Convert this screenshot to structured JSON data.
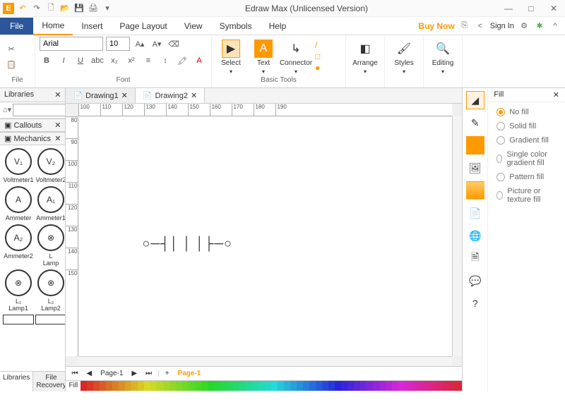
{
  "title": "Edraw Max (Unlicensed Version)",
  "menubar": {
    "file": "File",
    "items": [
      "Home",
      "Insert",
      "Page Layout",
      "View",
      "Symbols",
      "Help"
    ],
    "active": 0,
    "buynow": "Buy Now",
    "signin": "Sign In"
  },
  "ribbon": {
    "file_group": "File",
    "font_group": "Font",
    "font_name": "Arial",
    "font_size": "10",
    "basic_tools": "Basic Tools",
    "select": "Select",
    "text": "Text",
    "connector": "Connector",
    "arrange": "Arrange",
    "styles": "Styles",
    "editing": "Editing"
  },
  "libraries": {
    "title": "Libraries",
    "search_ph": "",
    "cats": [
      "Callouts",
      "Mechanics"
    ],
    "shapes": [
      {
        "sym": "V₁",
        "lbl": "Voltmeter1"
      },
      {
        "sym": "V₂",
        "lbl": "Voltmeter2"
      },
      {
        "sym": "A",
        "lbl": "Ammeter"
      },
      {
        "sym": "A₁",
        "lbl": "Ammeter1"
      },
      {
        "sym": "A₂",
        "lbl": "Ammeter2"
      },
      {
        "sym": "⊗",
        "sub": "L",
        "lbl": "Lamp"
      },
      {
        "sym": "⊗",
        "sub": "L₁",
        "lbl": "Lamp1"
      },
      {
        "sym": "⊗",
        "sub": "L₂",
        "lbl": "Lamp2"
      }
    ],
    "tabs": [
      "Libraries",
      "File Recovery"
    ]
  },
  "docs": {
    "tabs": [
      "Drawing1",
      "Drawing2"
    ],
    "active": 1
  },
  "ruler_h": [
    "100",
    "110",
    "120",
    "130",
    "140",
    "150",
    "160",
    "170",
    "180",
    "190"
  ],
  "ruler_v": [
    "80",
    "90",
    "100",
    "110",
    "120",
    "130",
    "140",
    "150"
  ],
  "pages": {
    "nav": "Page-1",
    "add": "+",
    "active": "Page-1"
  },
  "colorlabel": "Fill",
  "fill": {
    "title": "Fill",
    "options": [
      "No fill",
      "Solid fill",
      "Gradient fill",
      "Single color gradient fill",
      "Pattern fill",
      "Picture or texture fill"
    ],
    "selected": 0
  }
}
